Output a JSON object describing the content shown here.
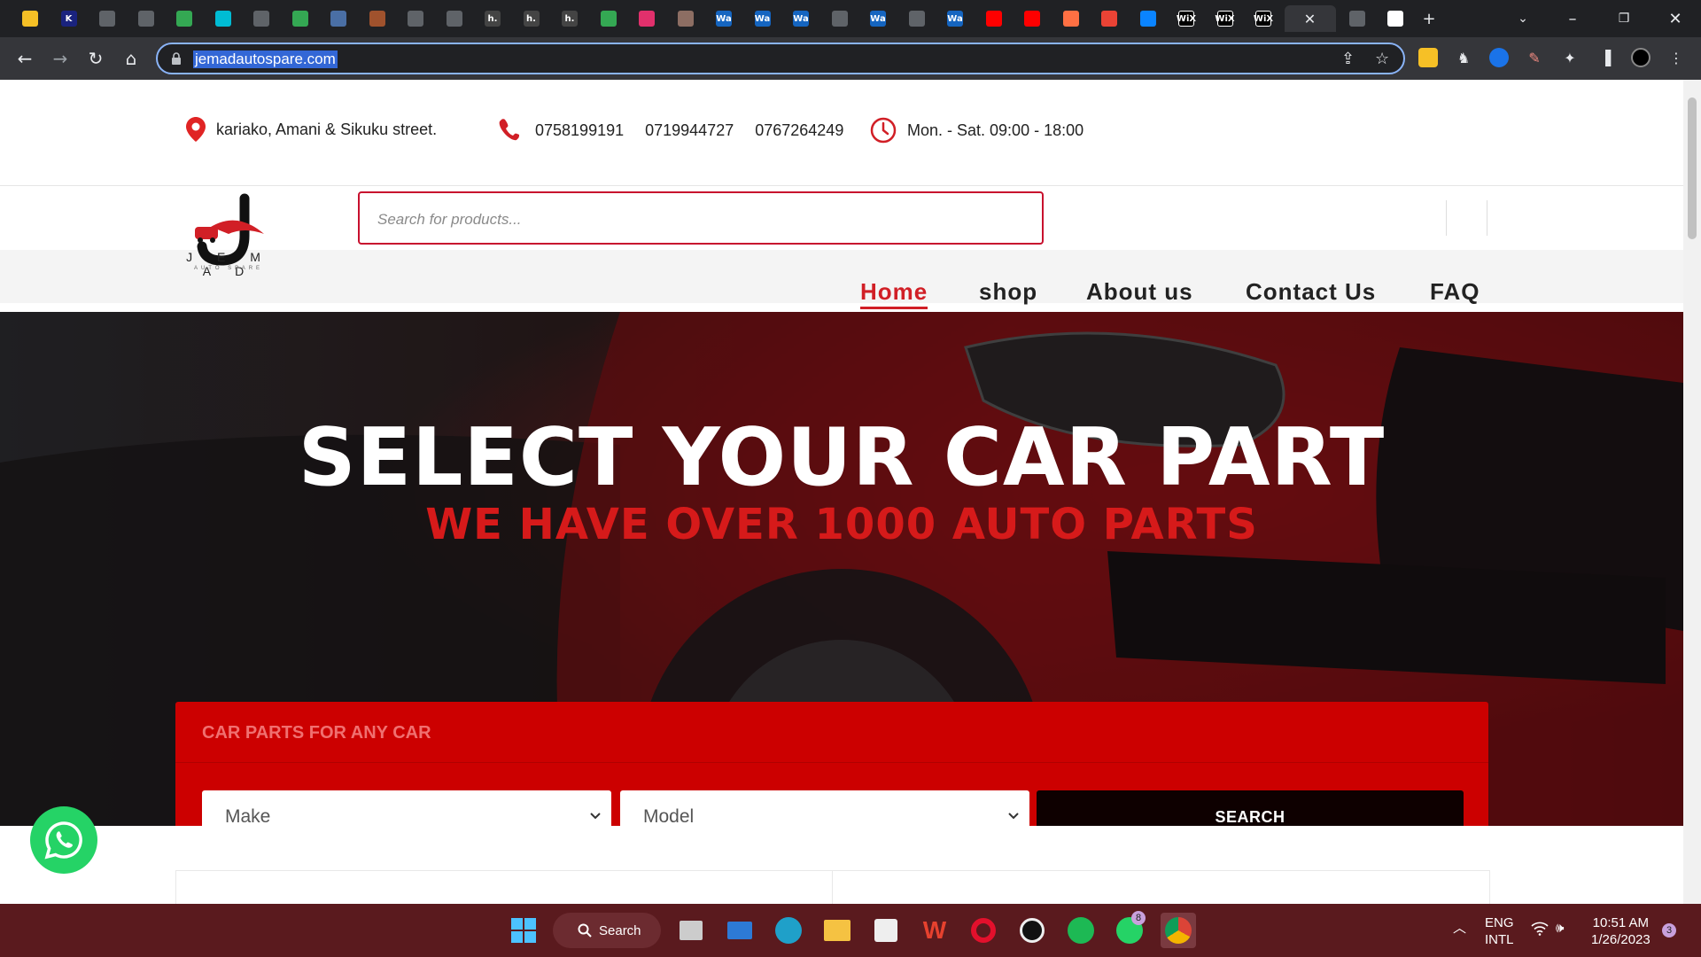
{
  "browser": {
    "tab_favicons": [
      "keep-icon",
      "k-icon",
      "globe-icon",
      "globe-icon",
      "sheets-icon",
      "grid-icon",
      "globe-icon",
      "sheets-icon",
      "inbox-icon",
      "hat-icon",
      "globe-icon",
      "globe-icon",
      "h-icon",
      "h-icon",
      "h-icon",
      "maps-icon",
      "instagram-icon",
      "avatar-icon",
      "wa-icon",
      "wa-icon",
      "wa-icon",
      "globe-icon",
      "wa-icon",
      "globe-icon",
      "wa-icon",
      "youtube-icon",
      "youtube-icon",
      "bolt-icon",
      "gmail-icon",
      "onedrive-icon",
      "wix-icon",
      "wix-icon",
      "wix-icon",
      "close-icon",
      "page-icon",
      "google-icon"
    ],
    "tab_labels": {
      "k": "K",
      "h": "h.",
      "wa": "Wa",
      "wix": "WiX",
      "close": "✕"
    },
    "new_tab": "+",
    "url": "jemadautospare.com"
  },
  "info": {
    "address": "kariako, Amani & Sikuku street.",
    "phones": [
      "0758199191",
      "0719944727",
      "0767264249"
    ],
    "hours": "Mon. - Sat. 09:00 - 18:00"
  },
  "logo": {
    "name": "J E M A D",
    "tagline": "AUTO SPARE"
  },
  "search": {
    "placeholder": "Search for products..."
  },
  "nav": {
    "items": [
      "Home",
      "shop",
      "About us",
      "Contact Us",
      "FAQ"
    ],
    "active": "Home"
  },
  "hero": {
    "title": "SELECT YOUR CAR PART",
    "subtitle": "WE HAVE OVER 1000 AUTO PARTS"
  },
  "finder": {
    "title": "CAR PARTS FOR ANY CAR",
    "make_label": "Make",
    "model_label": "Model",
    "button_label": "SEARCH"
  },
  "taskbar": {
    "search_label": "Search",
    "whatsapp_badge": "8",
    "lang": "ENG",
    "layout": "INTL",
    "time": "10:51 AM",
    "date": "1/26/2023",
    "notifications": "3"
  },
  "colors": {
    "accent_red": "#cc0000",
    "nav_active": "#d11f26",
    "taskbar": "#5a1a1e"
  }
}
